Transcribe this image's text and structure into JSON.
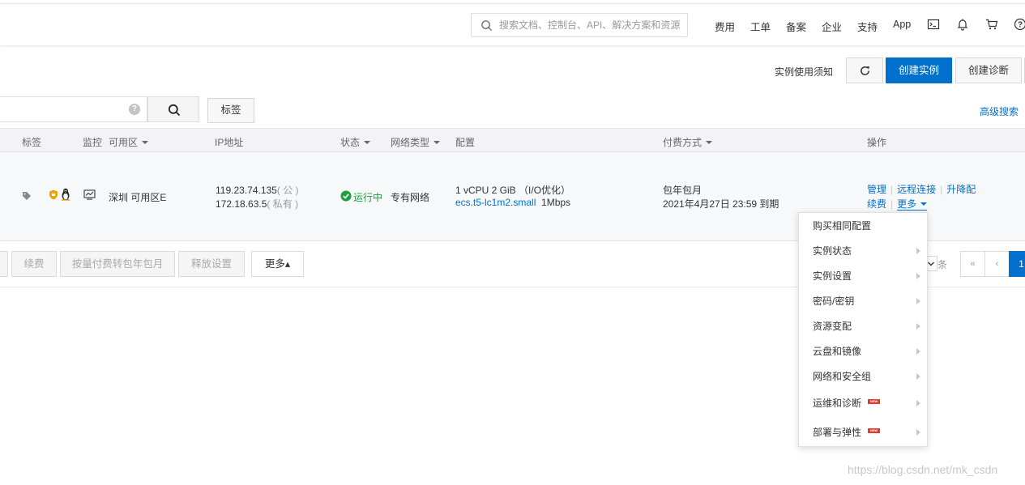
{
  "topnav": {
    "search_placeholder": "搜索文档、控制台、API、解决方案和资源",
    "links": [
      "费用",
      "工单",
      "备案",
      "企业",
      "支持",
      "App"
    ]
  },
  "actions": {
    "notice": "实例使用须知",
    "create_instance": "创建实例",
    "create_diagnosis": "创建诊断"
  },
  "filter": {
    "tag_button": "标签",
    "advanced_search": "高级搜索"
  },
  "table": {
    "headers": {
      "tag": "标签",
      "monitor": "监控",
      "zone": "可用区",
      "ip": "IP地址",
      "status": "状态",
      "network": "网络类型",
      "config": "配置",
      "billing": "付费方式",
      "ops": "操作"
    },
    "row": {
      "zone": "深圳 可用区E",
      "public_ip": "119.23.74.135",
      "public_suffix": "( 公 )",
      "private_ip": "172.18.63.5",
      "private_suffix": "( 私有 )",
      "status": "运行中",
      "network": "专有网络",
      "config_line1": "1 vCPU 2 GiB （I/O优化）",
      "instance_type": "ecs.t5-lc1m2.small",
      "bandwidth": "1Mbps",
      "billing_type": "包年包月",
      "expire": "2021年4月27日 23:59 到期",
      "op_manage": "管理",
      "op_remote": "远程连接",
      "op_upgrade": "升降配",
      "op_renew": "续费",
      "op_more": "更多"
    }
  },
  "bulk": {
    "renew": "续费",
    "convert": "按量付费转包年包月",
    "release": "释放设置",
    "more": "更多▴"
  },
  "pagination": {
    "unit": "条",
    "first": "«",
    "prev": "‹",
    "current": "1"
  },
  "more_menu": {
    "items": [
      {
        "label": "购买相同配置",
        "submenu": false,
        "new": false
      },
      {
        "label": "实例状态",
        "submenu": true,
        "new": false
      },
      {
        "label": "实例设置",
        "submenu": true,
        "new": false
      },
      {
        "label": "密码/密钥",
        "submenu": true,
        "new": false
      },
      {
        "label": "资源变配",
        "submenu": true,
        "new": false
      },
      {
        "label": "云盘和镜像",
        "submenu": true,
        "new": false
      },
      {
        "label": "网络和安全组",
        "submenu": true,
        "new": false
      },
      {
        "label": "运维和诊断",
        "submenu": true,
        "new": true
      },
      {
        "label": "部署与弹性",
        "submenu": true,
        "new": true
      }
    ],
    "new_badge": "NEW"
  },
  "watermark": "https://blog.csdn.net/mk_csdn",
  "colors": {
    "primary": "#0070cc",
    "running": "#1e9e3c",
    "new_badge": "#e23b2d"
  }
}
